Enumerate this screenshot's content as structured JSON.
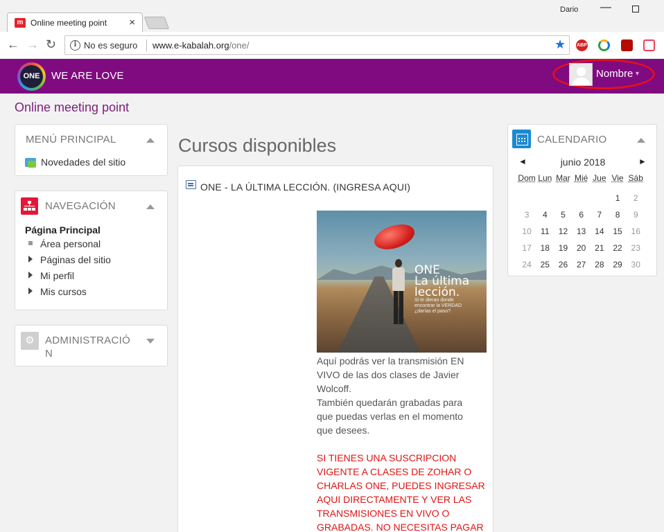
{
  "browser": {
    "tab_title": "Online meeting point",
    "favicon_text": "m",
    "user": "Dario",
    "not_secure": "No es seguro",
    "url_host": "www.e-kabalah.org",
    "url_path": "/one/",
    "extensions": [
      "ABP",
      "",
      "",
      ""
    ]
  },
  "header": {
    "brand": "WE ARE LOVE",
    "logo_text": "ONE",
    "user_label": "Nombre"
  },
  "page": {
    "heading": "Online meeting point"
  },
  "menu_block": {
    "title": "MENÚ PRINCIPAL",
    "item": "Novedades del sitio"
  },
  "nav_block": {
    "title": "NAVEGACIÓN",
    "home": "Página Principal",
    "items": [
      "Área personal",
      "Páginas del sitio",
      "Mi perfil",
      "Mis cursos"
    ]
  },
  "admin_block": {
    "title_line1": "ADMINISTRACIÓ",
    "title_line2": "N"
  },
  "main": {
    "heading": "Cursos disponibles",
    "course": {
      "title": "ONE - LA ÚLTIMA LECCIÓN. (INGRESA AQUI)",
      "image_text": [
        "ONE",
        "La última",
        "lección."
      ],
      "image_small": [
        "Si te dieran donde",
        "encontrar la VERDAD",
        "¿darías el paso?"
      ],
      "desc_lines": [
        "Aquí podrás ver la transmisión EN",
        "VIVO de las dos clases de Javier",
        "Wolcoff.",
        "También quedarán grabadas para",
        "que puedas verlas en el momento",
        "que desees."
      ],
      "alert_lines": [
        "SI TIENES UNA SUSCRIPCION",
        "VIGENTE A CLASES DE ZOHAR O",
        "CHARLAS ONE, PUEDES INGRESAR",
        "AQUI DIRECTAMENTE Y VER LAS",
        "TRANSMISIONES EN VIVO O",
        "GRABADAS. NO NECESITAS PAGAR NI"
      ]
    }
  },
  "calendar": {
    "title": "CALENDARIO",
    "month": "junio 2018",
    "prev": "◄",
    "next": "►",
    "day_headers": [
      "Dom",
      "Lun",
      "Mar",
      "Mié",
      "Jue",
      "Vie",
      "Sáb"
    ],
    "weeks": [
      [
        "",
        "",
        "",
        "",
        "",
        "1",
        "2"
      ],
      [
        "3",
        "4",
        "5",
        "6",
        "7",
        "8",
        "9"
      ],
      [
        "10",
        "11",
        "12",
        "13",
        "14",
        "15",
        "16"
      ],
      [
        "17",
        "18",
        "19",
        "20",
        "21",
        "22",
        "23"
      ],
      [
        "24",
        "25",
        "26",
        "27",
        "28",
        "29",
        "30"
      ]
    ]
  },
  "colors": {
    "header_bg": "#800a80",
    "accent": "#7a1f7a",
    "alert": "#e01414",
    "highlight_circle": "#e0101e"
  }
}
